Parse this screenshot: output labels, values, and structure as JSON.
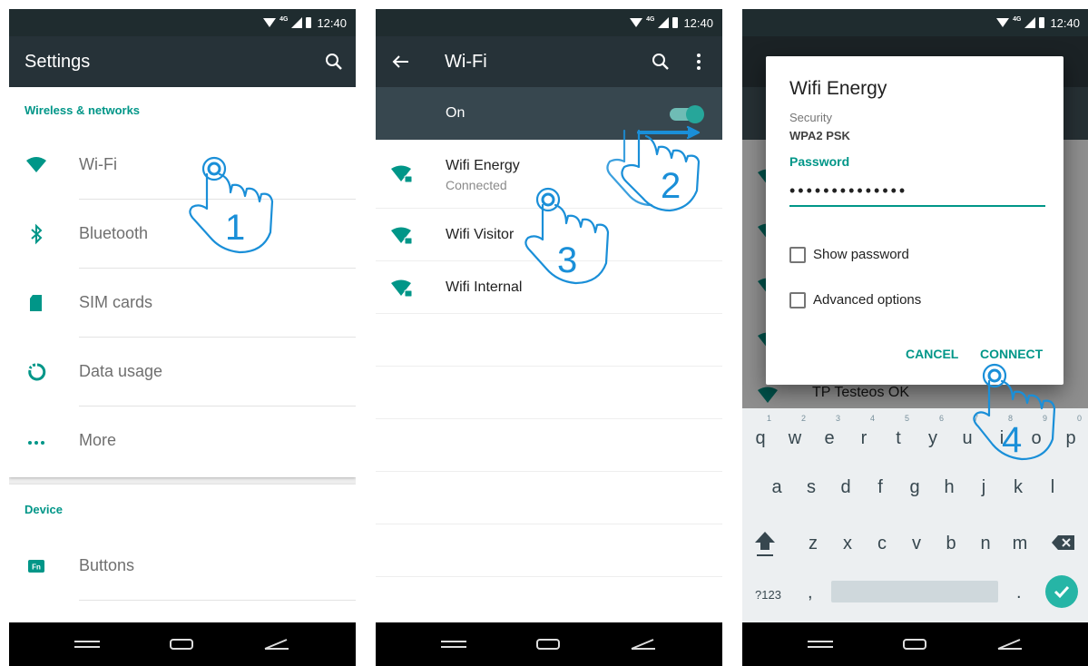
{
  "status_time": "12:40",
  "status_network": "4G",
  "panel1": {
    "title": "Settings",
    "section_wireless": "Wireless & networks",
    "items": [
      {
        "label": "Wi-Fi",
        "icon": "wifi-icon"
      },
      {
        "label": "Bluetooth",
        "icon": "bluetooth-icon"
      },
      {
        "label": "SIM cards",
        "icon": "sim-card-icon"
      },
      {
        "label": "Data usage",
        "icon": "data-usage-icon"
      },
      {
        "label": "More",
        "icon": "more-icon"
      }
    ],
    "section_device": "Device",
    "device_items": [
      {
        "label": "Buttons",
        "icon": "fn-buttons-icon"
      }
    ]
  },
  "panel2": {
    "title": "Wi-Fi",
    "switch_label": "On",
    "switch_on": true,
    "networks": [
      {
        "name": "Wifi Energy",
        "status": "Connected"
      },
      {
        "name": "Wifi Visitor",
        "status": ""
      },
      {
        "name": "Wifi Internal",
        "status": ""
      }
    ]
  },
  "panel3": {
    "background_network": "TP Testeos OK",
    "dialog": {
      "title": "Wifi Energy",
      "security_label": "Security",
      "security_value": "WPA2 PSK",
      "password_label": "Password",
      "password_value": "••••••••••••••",
      "show_password": "Show password",
      "advanced_options": "Advanced options",
      "cancel": "CANCEL",
      "connect": "CONNECT"
    },
    "keyboard": {
      "row1": [
        "q",
        "w",
        "e",
        "r",
        "t",
        "y",
        "u",
        "i",
        "o",
        "p"
      ],
      "row1_nums": [
        "1",
        "2",
        "3",
        "4",
        "5",
        "6",
        "7",
        "8",
        "9",
        "0"
      ],
      "row2": [
        "a",
        "s",
        "d",
        "f",
        "g",
        "h",
        "j",
        "k",
        "l"
      ],
      "row3": [
        "z",
        "x",
        "c",
        "v",
        "b",
        "n",
        "m"
      ],
      "symbols_key": "?123",
      "comma": ",",
      "period": "."
    }
  },
  "steps": [
    "1",
    "2",
    "3",
    "4"
  ],
  "colors": {
    "accent": "#009688",
    "appbar": "#263238",
    "statusbar": "#1f2c2f",
    "switchbar": "#37474f",
    "gesture": "#1a8fd8"
  }
}
